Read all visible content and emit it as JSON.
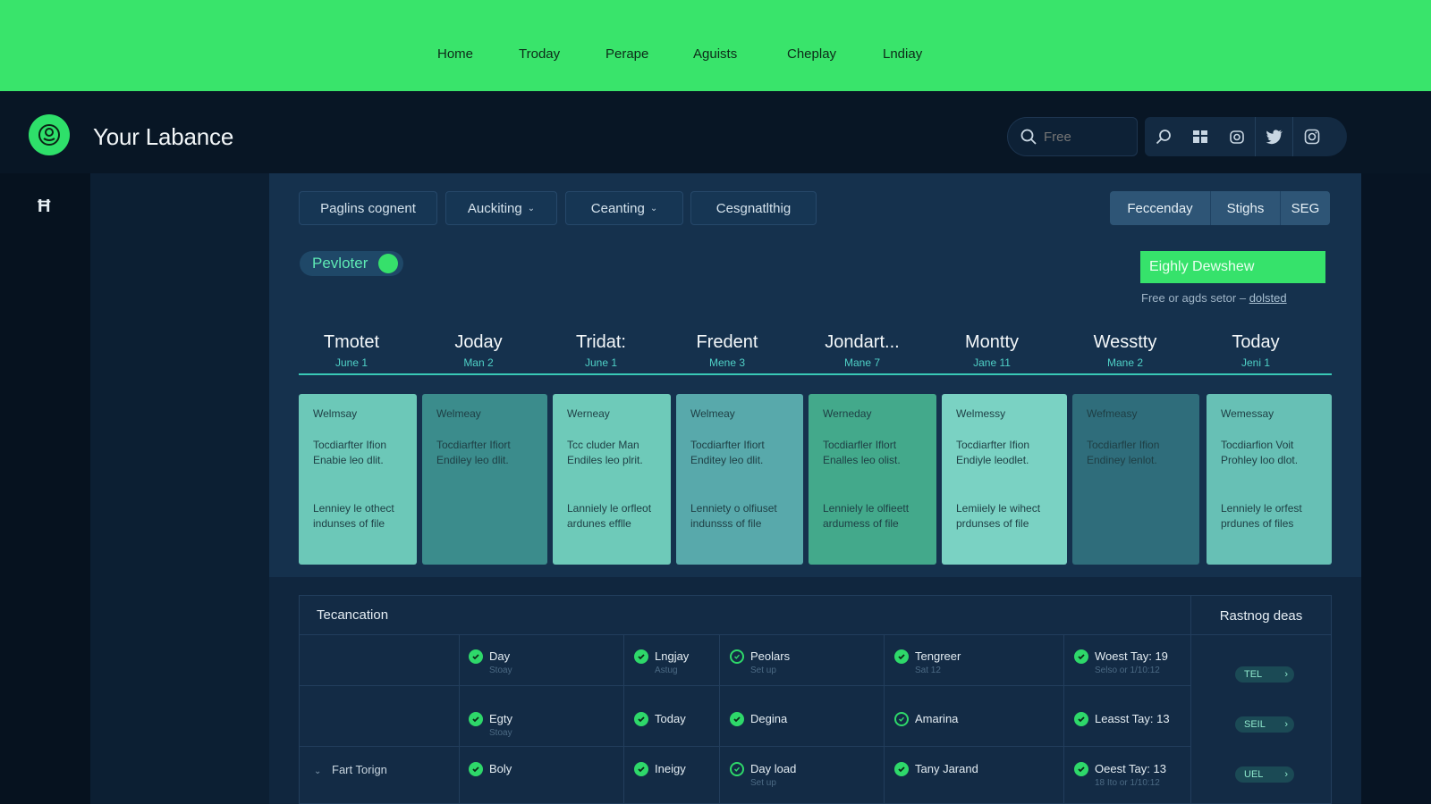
{
  "topnav": {
    "items": [
      "Home",
      "Troday",
      "Perape",
      "Aguists",
      "Cheplay",
      "Lndiay"
    ]
  },
  "header": {
    "title": "Your Labance",
    "search_placeholder": "Free",
    "icons": [
      "search-icon",
      "grid-icon",
      "camera-icon",
      "twitter-icon",
      "instagram-icon"
    ]
  },
  "rail": {
    "icon_glyph": "Ħ"
  },
  "filters": {
    "buttons": [
      "Paglins cognent",
      "Auckiting",
      "Ceanting",
      "Cesgnatlthig"
    ],
    "chevron": "⌄",
    "segments": [
      "Feccenday",
      "Stighs",
      "SEG"
    ]
  },
  "pill": {
    "label": "Pevloter"
  },
  "cta": {
    "label": "Eighly Dewshew",
    "note_prefix": "Free or agds setor –",
    "note_link": "dolsted"
  },
  "days": [
    {
      "name": "Tmotet",
      "date": "June 1",
      "card_title": "Welmsay",
      "text1": "Tocdiarfter Ifion Enabie leo dlit.",
      "text2": "Lenniey le othect indunses of file",
      "color": "#6cc8b8"
    },
    {
      "name": "Joday",
      "date": "Man 2",
      "card_title": "Welmeay",
      "text1": "Tocdiarfter Ifiort Endiley leo dlit.",
      "text2": "",
      "color": "#3b8c8c"
    },
    {
      "name": "Tridat:",
      "date": "June 1",
      "card_title": "Werneay",
      "text1": "Tcc cluder Man Endiles leo plrit.",
      "text2": "Lanniely le orfleot ardunes efflle",
      "color": "#6ecab9"
    },
    {
      "name": "Fredent",
      "date": "Mene 3",
      "card_title": "Welmeay",
      "text1": "Tocdiarfter Ifiort Enditey leo dlit.",
      "text2": "Lenniety o olfiuset indunsss of file",
      "color": "#58a9ab"
    },
    {
      "name": "Jondart...",
      "date": "Mane 7",
      "card_title": "Werneday",
      "text1": "Tocdiarfler Iflort Enalles leo olist.",
      "text2": "Lenniely le olfieett ardumess of file",
      "color": "#43a98b"
    },
    {
      "name": "Montty",
      "date": "Jane 11",
      "card_title": "Welmessy",
      "text1": "Tocdiarfter Ifion Endiyle leodlet.",
      "text2": "Lemiiely le wihect prdunses of file",
      "color": "#7ad2c3"
    },
    {
      "name": "Wesstty",
      "date": "Mane 2",
      "card_title": "Wefmeasy",
      "text1": "Tocdiarfler Ifion Endiney lenlot.",
      "text2": "",
      "color": "#2f6d7b"
    },
    {
      "name": "Today",
      "date": "Jeni 1",
      "card_title": "Wemessay",
      "text1": "Tocdiarfion Voit Prohley loo dlot.",
      "text2": "Lenniely le orfest prdunes of files",
      "color": "#67c0b5"
    }
  ],
  "table": {
    "title": "Tecancation",
    "right_header": "Rastnog deas",
    "rows": [
      {
        "label": "",
        "cells": [
          {
            "text": "Day",
            "sub": "Stoay",
            "ring": false
          },
          {
            "text": "Lngjay",
            "sub": "Astug",
            "ring": false
          },
          {
            "text": "Peolars",
            "sub": "Set up",
            "ring": true
          },
          {
            "text": "Tengreer",
            "sub": "Sat 12",
            "ring": false
          },
          {
            "text": "Woest Tay: 19",
            "sub": "Selso or 1/10:12",
            "ring": false
          }
        ],
        "tag": "TEL"
      },
      {
        "label": "",
        "cells": [
          {
            "text": "Egty",
            "sub": "Stoay",
            "ring": false
          },
          {
            "text": "Today",
            "sub": "",
            "ring": false
          },
          {
            "text": "Degina",
            "sub": "",
            "ring": false
          },
          {
            "text": "Amarina",
            "sub": "",
            "ring": true
          },
          {
            "text": "Leasst Tay: 13",
            "sub": "",
            "ring": false
          }
        ],
        "tag": "SEIL"
      },
      {
        "label": "Fart Torign",
        "cells": [
          {
            "text": "Boly",
            "sub": "",
            "ring": false
          },
          {
            "text": "Ineigy",
            "sub": "",
            "ring": false
          },
          {
            "text": "Day load",
            "sub": "Set up",
            "ring": true
          },
          {
            "text": "Tany Jarand",
            "sub": "",
            "ring": false
          },
          {
            "text": "Oeest Tay: 13",
            "sub": "18 Ito or 1/10:12",
            "ring": false
          }
        ],
        "tag": "UEL"
      }
    ],
    "row_toggle": "⌄",
    "tag_arrow": "›"
  }
}
